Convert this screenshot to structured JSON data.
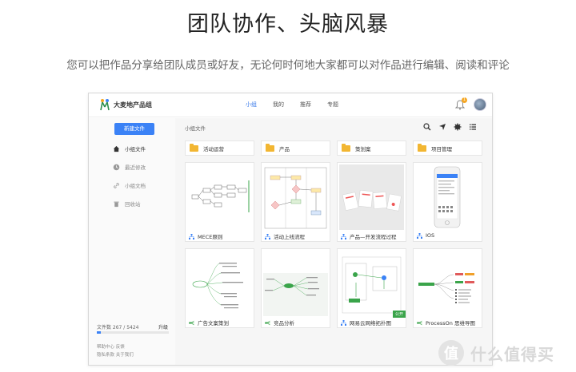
{
  "hero": {
    "title": "团队协作、头脑风暴",
    "subtitle": "您可以把作品分享给团队成员或好友，无论何时何地大家都可以对作品进行编辑、阅读和评论"
  },
  "app": {
    "brand": "大麦地产品组",
    "nav": [
      {
        "label": "小组",
        "active": true
      },
      {
        "label": "我的",
        "active": false
      },
      {
        "label": "推荐",
        "active": false
      },
      {
        "label": "专题",
        "active": false
      }
    ],
    "notification_count": "1",
    "sidebar": {
      "new_button": "新建文件",
      "items": [
        {
          "label": "小组文件",
          "icon": "home-icon"
        },
        {
          "label": "最近修改",
          "icon": "clock-icon"
        },
        {
          "label": "小组文档",
          "icon": "link-icon"
        },
        {
          "label": "回收站",
          "icon": "trash-icon"
        }
      ],
      "storage_label": "文件数 267 / 5424",
      "storage_fraction": 0.05,
      "upgrade": "升级",
      "footer_line1": "帮助中心  反馈",
      "footer_line2": "隐私条款  关于我们"
    },
    "main": {
      "breadcrumb": "小组文件",
      "folders": [
        "活动运营",
        "产品",
        "策划案",
        "项目管理"
      ],
      "cards": [
        {
          "title": "MECE原则",
          "type": "flow"
        },
        {
          "title": "活动上线流程",
          "type": "flow"
        },
        {
          "title": "产品—开发流程过程",
          "type": "flow"
        },
        {
          "title": "IOS",
          "type": "flow"
        },
        {
          "title": "广告文案策划",
          "type": "mind"
        },
        {
          "title": "竞品分析",
          "type": "mind"
        },
        {
          "title": "网易云网络拓扑图",
          "type": "flow",
          "badge": "公开"
        },
        {
          "title": "ProcessOn 思维导图",
          "type": "mind"
        }
      ]
    }
  },
  "watermark": {
    "glyph": "值",
    "text": "什么值得买"
  },
  "colors": {
    "accent": "#3b82f6",
    "folder": "#f2b632",
    "badge": "#3aa44a"
  }
}
